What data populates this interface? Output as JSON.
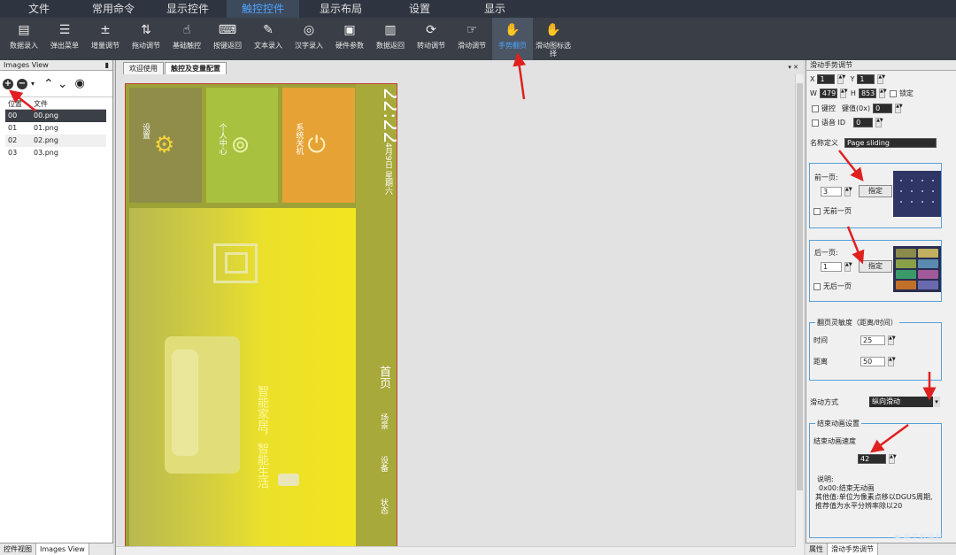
{
  "menu": [
    "文件",
    "常用命令",
    "显示控件",
    "触控控件",
    "显示布局",
    "设置",
    "显示"
  ],
  "toolbar": [
    {
      "label": "数据录入",
      "icon": "data-entry-icon"
    },
    {
      "label": "弹出菜单",
      "icon": "popup-menu-icon"
    },
    {
      "label": "增量调节",
      "icon": "increment-icon"
    },
    {
      "label": "拖动调节",
      "icon": "drag-adjust-icon"
    },
    {
      "label": "基础触控",
      "icon": "touch-icon"
    },
    {
      "label": "按键返回",
      "icon": "key-return-icon"
    },
    {
      "label": "文本录入",
      "icon": "text-entry-icon"
    },
    {
      "label": "汉字录入",
      "icon": "chinese-input-icon"
    },
    {
      "label": "硬件参数",
      "icon": "hardware-icon"
    },
    {
      "label": "数据返回",
      "icon": "data-return-icon"
    },
    {
      "label": "转动调节",
      "icon": "rotate-adjust-icon"
    },
    {
      "label": "滑动调节",
      "icon": "slide-adjust-icon"
    },
    {
      "label": "手势翻页",
      "icon": "gesture-page-icon"
    },
    {
      "label": "滑动图标选择",
      "icon": "hand-icon"
    }
  ],
  "images_view": {
    "title": "Images View",
    "headers": [
      "位置",
      "文件"
    ],
    "rows": [
      [
        "00",
        "00.png"
      ],
      [
        "01",
        "01.png"
      ],
      [
        "02",
        "02.png"
      ],
      [
        "03",
        "03.png"
      ]
    ]
  },
  "bottom_left_tabs": [
    "控件视图",
    "Images View"
  ],
  "canvas_tabs": [
    "欢迎使用",
    "触控及变量配置"
  ],
  "device": {
    "time": "22:22",
    "date": "4月9日",
    "weekday": "星期六",
    "tiles": [
      "设置",
      "个人中心",
      "系统关机"
    ],
    "nav": [
      "首页",
      "场景",
      "设备",
      "状态"
    ],
    "slogan": "智能家居，智能生活"
  },
  "props": {
    "title": "滑动手势调节",
    "x": "1",
    "y": "1",
    "w": "479",
    "h": "853",
    "lock_label": "锁定",
    "key_label": "键控",
    "key_value_label": "键值(0x)",
    "key_value": "0",
    "voice_label": "语音 ID",
    "voice_id": "0",
    "name_label": "名称定义",
    "name_value": "Page sliding",
    "prev_label": "前一页:",
    "prev_value": "3",
    "prev_btn": "指定",
    "no_prev": "无前一页",
    "next_label": "后一页:",
    "next_value": "1",
    "next_btn": "指定",
    "no_next": "无后一页",
    "sens_title": "翻页灵敏度（距离/时间）",
    "time_label": "时间",
    "time_value": "25",
    "dist_label": "距离",
    "dist_value": "50",
    "slide_label": "滑动方式",
    "slide_value": "纵向滑动",
    "anim_title": "结束动画设置",
    "anim_speed_label": "结束动画速度",
    "anim_speed": "42",
    "note_title": "说明:",
    "note_lines": [
      "0x00:结束无动画",
      "其他值:单位为像素点移以DGUS周期,",
      "推荐值为水平分辨率除以20"
    ]
  },
  "bottom_right_tabs": [
    "属性",
    "滑动手势调节"
  ],
  "watermark": "电子发烧友"
}
